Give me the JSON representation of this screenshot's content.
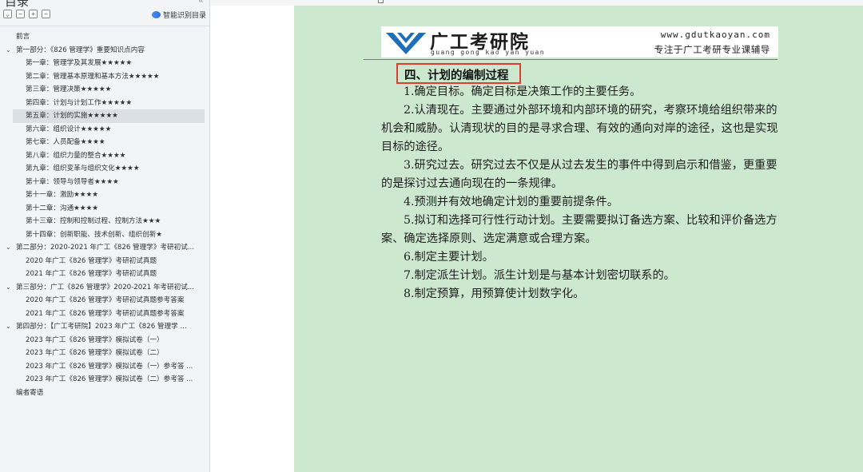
{
  "toc": {
    "header_title": "目录",
    "smart_toc_label": "智能识别目录",
    "toolbar_glyphs": [
      "⌄",
      "−",
      "+",
      "−"
    ],
    "items": [
      {
        "label": "前言",
        "level": 0,
        "expandable": false,
        "active": false
      },
      {
        "label": "第一部分：《826 管理学》重要知识点内容",
        "level": 0,
        "expandable": true,
        "active": false
      },
      {
        "label": "第一章：管理学及其发展★★★★★",
        "level": 1,
        "expandable": false,
        "active": false
      },
      {
        "label": "第二章：管理基本原理和基本方法★★★★★",
        "level": 1,
        "expandable": false,
        "active": false
      },
      {
        "label": "第三章：管理决策★★★★★",
        "level": 1,
        "expandable": false,
        "active": false
      },
      {
        "label": "第四章：计划与计划工作★★★★★",
        "level": 1,
        "expandable": false,
        "active": false
      },
      {
        "label": "第五章：计划的实施★★★★★",
        "level": 1,
        "expandable": false,
        "active": true
      },
      {
        "label": "第六章：组织设计★★★★★",
        "level": 1,
        "expandable": false,
        "active": false
      },
      {
        "label": "第七章：人员配备★★★★",
        "level": 1,
        "expandable": false,
        "active": false
      },
      {
        "label": "第八章：组织力量的整合★★★★",
        "level": 1,
        "expandable": false,
        "active": false
      },
      {
        "label": "第九章：组织变革与组织文化★★★★",
        "level": 1,
        "expandable": false,
        "active": false
      },
      {
        "label": "第十章：领导与领导者★★★★",
        "level": 1,
        "expandable": false,
        "active": false
      },
      {
        "label": "第十一章：激励★★★★",
        "level": 1,
        "expandable": false,
        "active": false
      },
      {
        "label": "第十二章：沟通★★★★",
        "level": 1,
        "expandable": false,
        "active": false
      },
      {
        "label": "第十三章：控制和控制过程、控制方法★★★",
        "level": 1,
        "expandable": false,
        "active": false
      },
      {
        "label": "第十四章：创新职能、技术创新、组织创新★",
        "level": 1,
        "expandable": false,
        "active": false
      },
      {
        "label": "第二部分：2020-2021 年广工《826 管理学》考研初试...",
        "level": 0,
        "expandable": true,
        "active": false
      },
      {
        "label": "2020 年广工《826 管理学》考研初试真题",
        "level": 1,
        "expandable": false,
        "active": false
      },
      {
        "label": "2021 年广工《826 管理学》考研初试真题",
        "level": 1,
        "expandable": false,
        "active": false
      },
      {
        "label": "第三部分：广工《826 管理学》2020-2021 年考研初试...",
        "level": 0,
        "expandable": true,
        "active": false
      },
      {
        "label": "2020 年广工《826 管理学》考研初试真题参考答案",
        "level": 1,
        "expandable": false,
        "active": false
      },
      {
        "label": "2021 年广工《826 管理学》考研初试真题参考答案",
        "level": 1,
        "expandable": false,
        "active": false
      },
      {
        "label": "第四部分：【广工考研院】2023 年广工《826 管理学 ...",
        "level": 0,
        "expandable": true,
        "active": false
      },
      {
        "label": "2023 年广工《826 管理学》模拟试卷（一）",
        "level": 1,
        "expandable": false,
        "active": false
      },
      {
        "label": "2023 年广工《826 管理学》模拟试卷（二）",
        "level": 1,
        "expandable": false,
        "active": false
      },
      {
        "label": "2023 年广工《826 管理学》模拟试卷（一）参考答 ...",
        "level": 1,
        "expandable": false,
        "active": false
      },
      {
        "label": "2023 年广工《826 管理学》模拟试卷（二）参考答 ...",
        "level": 1,
        "expandable": false,
        "active": false
      },
      {
        "label": "编者寄语",
        "level": 0,
        "expandable": false,
        "active": false
      }
    ]
  },
  "doc": {
    "brand_name": "广工考研院",
    "brand_pinyin": "guang gong kao yan yuan",
    "site_url": "www.gdutkaoyan.com",
    "slogan": "专注于广工考研专业课辅导",
    "section_title": "四、计划的编制过程",
    "paragraphs": [
      [
        "1.确定目标。确定目标是决策工作的主要任务。"
      ],
      [
        "2.认清现在。主要通过外部环境和内部环境的研究，考察环境给组织带来的",
        "机会和威胁。认清现状的目的是寻求合理、有效的通向对岸的途径，这也是实现",
        "目标的途径。"
      ],
      [
        "3.研究过去。研究过去不仅是从过去发生的事件中得到启示和借鉴，更重要",
        "的是探讨过去通向现在的一条规律。"
      ],
      [
        "4.预测并有效地确定计划的重要前提条件。"
      ],
      [
        "5.拟订和选择可行性行动计划。主要需要拟订备选方案、比较和评价备选方",
        "案、确定选择原则、选定满意或合理方案。"
      ],
      [
        "6.制定主要计划。"
      ],
      [
        "7.制定派生计划。派生计划是与基本计划密切联系的。"
      ],
      [
        "8.制定预算，用预算使计划数字化。"
      ]
    ]
  },
  "colors": {
    "page_bg": "#cce8cf",
    "highlight_border": "#e23b30",
    "logo_blue": "#1f6fb8",
    "toc_active": "#dcdfe4"
  }
}
